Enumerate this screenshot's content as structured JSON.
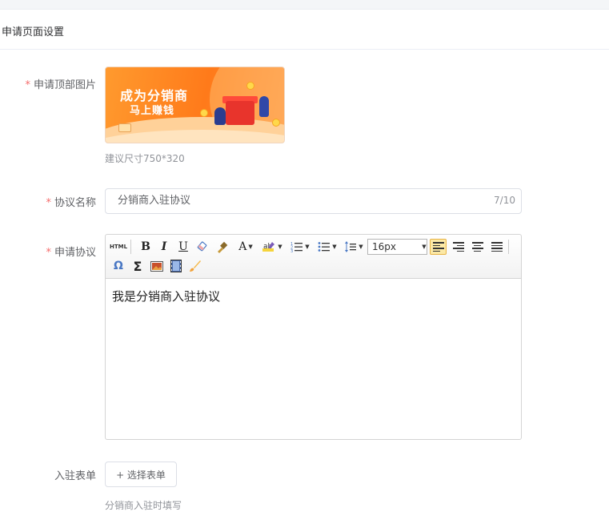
{
  "section": {
    "title": "申请页面设置"
  },
  "fields": {
    "top_image": {
      "label": "申请顶部图片",
      "banner_line1": "成为分销商",
      "banner_line2": "马上赚钱",
      "hint": "建议尺寸750*320"
    },
    "agreement_name": {
      "label": "协议名称",
      "value": "分销商入驻协议",
      "counter": "7/10"
    },
    "agreement": {
      "label": "申请协议",
      "font_size": "16px",
      "content": "我是分销商入驻协议"
    },
    "entry_form": {
      "label": "入驻表单",
      "button": "+ 选择表单",
      "hint": "分销商入驻时填写"
    }
  },
  "toolbar": {
    "html_label": "HTML",
    "bold": "B",
    "italic": "I",
    "underline": "U",
    "font_color": "A",
    "omega": "Ω",
    "sigma": "Σ"
  },
  "colors": {
    "required": "#f56c6c",
    "banner": "#ff7a1a",
    "active_tool": "#fce9a6"
  }
}
